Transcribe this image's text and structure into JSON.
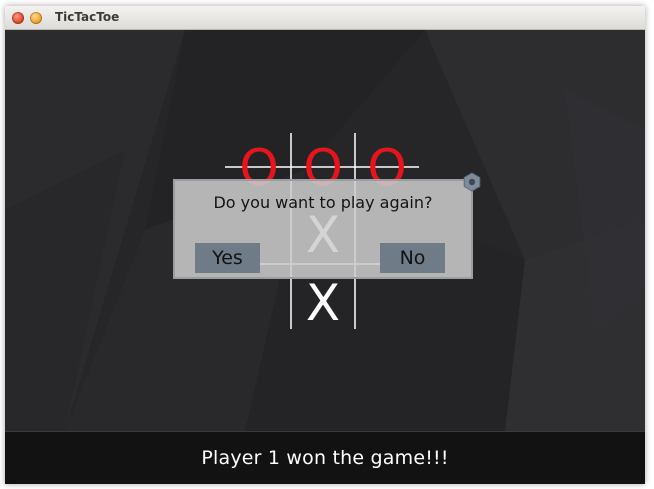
{
  "window": {
    "title": "TicTacToe"
  },
  "board": {
    "cells": [
      "O",
      "O",
      "O",
      "",
      "X",
      "",
      "",
      "X",
      ""
    ]
  },
  "dialog": {
    "message": "Do you want to play again?",
    "yes_label": "Yes",
    "no_label": "No"
  },
  "status": {
    "text": "Player 1 won the game!!!"
  },
  "colors": {
    "o_mark": "#e8141c",
    "x_mark": "#ffffff",
    "background": "#262628",
    "dialog_button": "#707b88"
  },
  "icons": {
    "close": "close-icon",
    "minimize": "minimize-icon",
    "gear": "gear-icon"
  }
}
